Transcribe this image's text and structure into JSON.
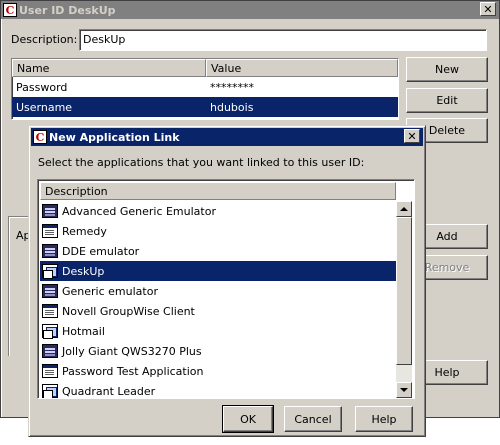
{
  "main_window": {
    "title": "User ID DeskUp",
    "app_icon_letter": "C",
    "description_label": "Description:",
    "description_value": "DeskUp",
    "grid": {
      "columns": [
        "Name",
        "Value"
      ],
      "rows": [
        {
          "name": "Password",
          "value": "********",
          "selected": false
        },
        {
          "name": "Username",
          "value": "hdubois",
          "selected": true
        }
      ]
    },
    "buttons": {
      "new": "New",
      "edit": "Edit",
      "delete": "Delete",
      "add": "Add",
      "remove": "Remove",
      "help": "Help"
    },
    "partial_label": "Ap"
  },
  "dialog": {
    "title": "New Application Link",
    "app_icon_letter": "C",
    "close_glyph": "✕",
    "instruction": "Select the applications that you want linked to this user ID:",
    "list_header": "Description",
    "items": [
      {
        "label": "Advanced Generic Emulator",
        "icon": "terminal-icon",
        "selected": false
      },
      {
        "label": "Remedy",
        "icon": "window-icon",
        "selected": false
      },
      {
        "label": "DDE emulator",
        "icon": "terminal-icon",
        "selected": false
      },
      {
        "label": "DeskUp",
        "icon": "stacked-windows-icon",
        "selected": true
      },
      {
        "label": "Generic emulator",
        "icon": "terminal-icon",
        "selected": false
      },
      {
        "label": "Novell GroupWise Client",
        "icon": "window-icon",
        "selected": false
      },
      {
        "label": "Hotmail",
        "icon": "stacked-windows-icon",
        "selected": false
      },
      {
        "label": "Jolly Giant QWS3270 Plus",
        "icon": "terminal-icon",
        "selected": false
      },
      {
        "label": "Password Test Application",
        "icon": "window-icon",
        "selected": false
      },
      {
        "label": "Quadrant Leader",
        "icon": "stacked-windows-icon",
        "selected": false
      }
    ],
    "buttons": {
      "ok": "OK",
      "cancel": "Cancel",
      "help": "Help"
    }
  },
  "colors": {
    "face": "#d4d0c8",
    "selection": "#0a246a",
    "inactive_title": "#808080",
    "brand_red": "#c00000"
  }
}
